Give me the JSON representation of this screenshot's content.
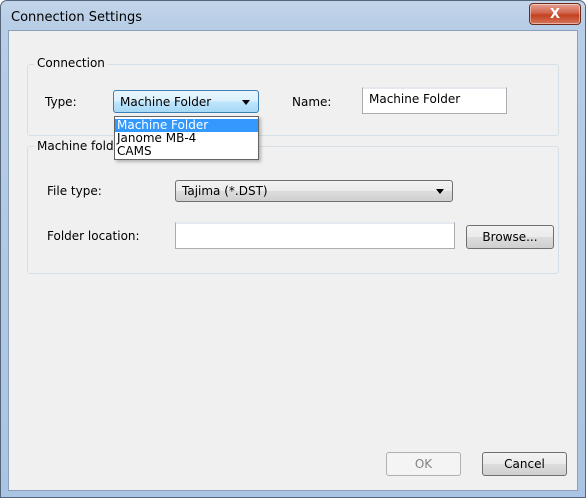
{
  "window": {
    "title": "Connection Settings",
    "close_glyph": "X"
  },
  "connection_group": {
    "label": "Connection",
    "type_label": "Type:",
    "type_value": "Machine Folder",
    "name_label": "Name:",
    "name_value": "Machine Folder"
  },
  "type_dropdown": {
    "options": [
      "Machine Folder",
      "Janome MB-4",
      "CAMS"
    ],
    "selected_index": 0
  },
  "machine_folder_group": {
    "label": "Machine folder",
    "file_type_label": "File type:",
    "file_type_value": "Tajima (*.DST)",
    "folder_location_label": "Folder location:",
    "folder_location_value": "",
    "browse_label": "Browse..."
  },
  "footer": {
    "ok_label": "OK",
    "cancel_label": "Cancel"
  },
  "colors": {
    "selection": "#3399ff",
    "window_frame": "#b8cde6",
    "close_button": "#c7452a"
  }
}
